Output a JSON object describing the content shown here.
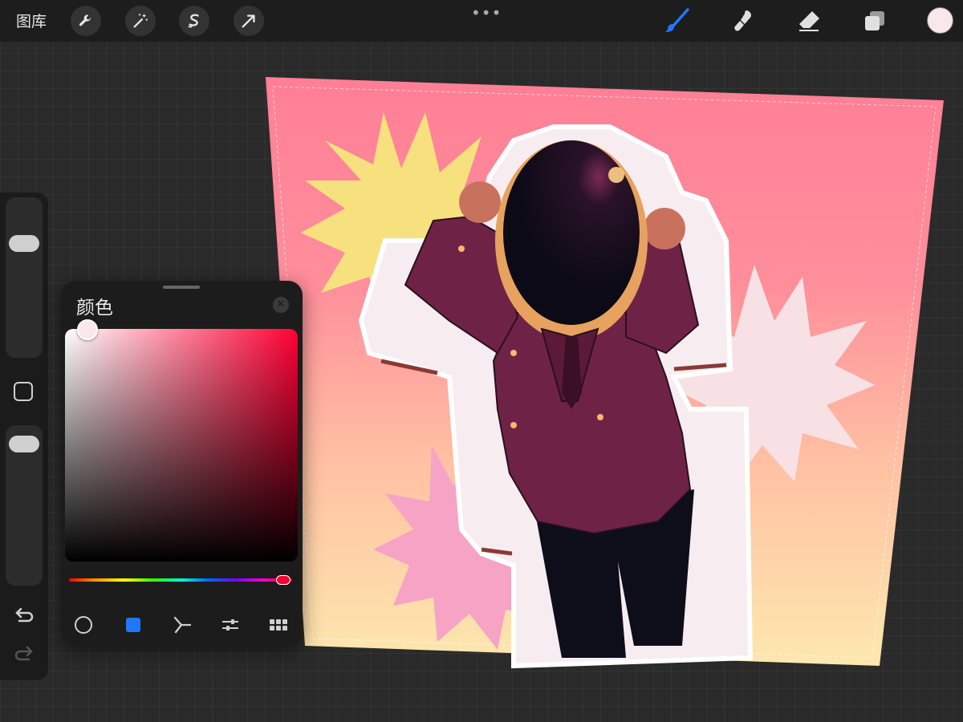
{
  "toolbar": {
    "gallery_label": "图库",
    "more_label": "•••",
    "tools_left": [
      "wrench-icon",
      "magic-wand-icon",
      "selection-icon",
      "transform-arrow-icon"
    ],
    "tools_right": [
      "brush-icon",
      "smudge-icon",
      "eraser-icon",
      "layers-icon"
    ],
    "active_tool": "brush-icon",
    "accent_color": "#1e78ff",
    "current_color": "#f9e7ea"
  },
  "sidebar": {
    "brush_size_level": 0.75,
    "opacity_level": 0.95,
    "undo_icon": "undo-arrow-icon",
    "redo_icon": "redo-arrow-icon"
  },
  "color_panel": {
    "title": "颜色",
    "close_icon": "close-icon",
    "hue_color": "#ff0033",
    "selected_color": "#f9e7ea",
    "modes": [
      "disc-icon",
      "classic-icon",
      "harmony-icon",
      "value-icon",
      "palettes-icon"
    ],
    "active_mode": "classic-icon"
  }
}
